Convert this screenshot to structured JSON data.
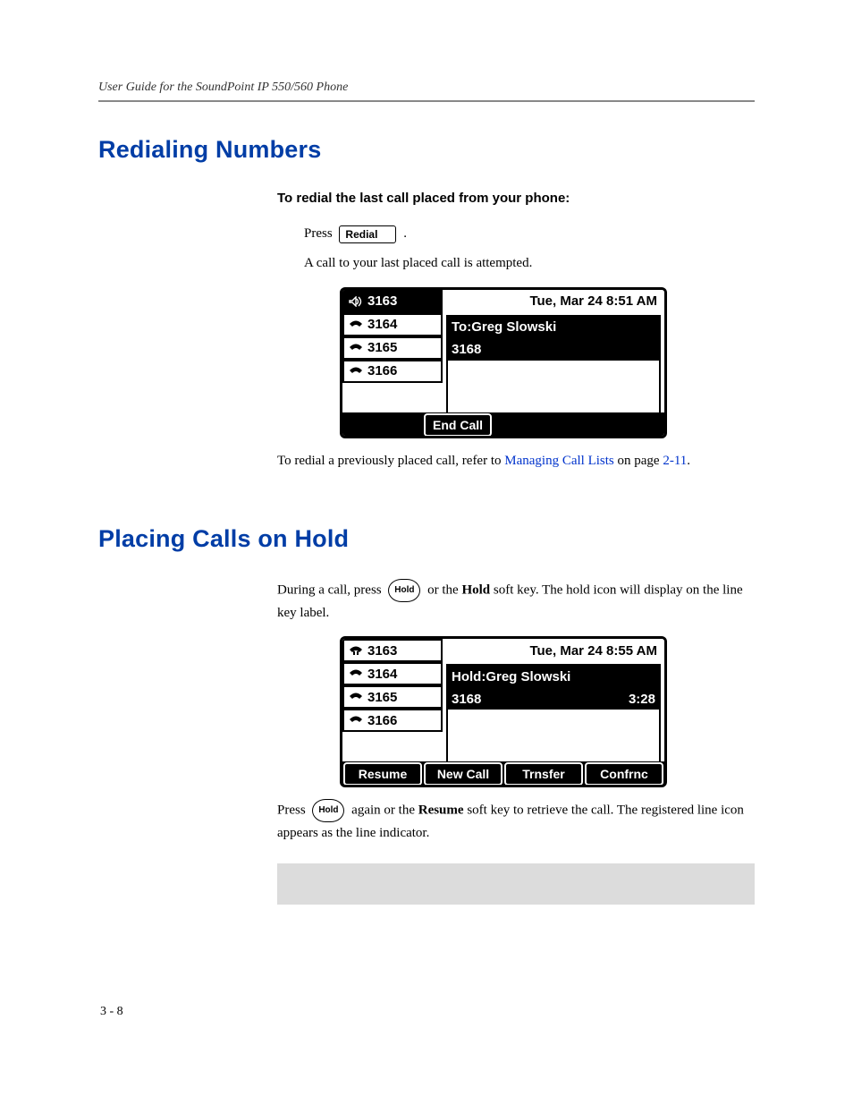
{
  "header": "User Guide for the SoundPoint IP 550/560 Phone",
  "page_num": "3 - 8",
  "sec1": {
    "title": "Redialing Numbers",
    "subhead": "To redial the last call placed from your phone:",
    "press_prefix": "Press ",
    "redial_label": "Redial",
    "press_suffix": " .",
    "line2": "A call to your last placed call is attempted.",
    "ref_prefix": "To redial a previously placed call, refer to ",
    "ref_link": "Managing Call Lists",
    "ref_mid": " on page ",
    "ref_page": "2-11",
    "ref_suffix": "."
  },
  "screen1": {
    "lines": [
      "3163",
      "3164",
      "3165",
      "3166"
    ],
    "datetime": "Tue, Mar 24  8:51 AM",
    "to": "To:Greg Slowski",
    "num": "3168",
    "softkeys": [
      "End Call"
    ]
  },
  "sec2": {
    "title": "Placing Calls on Hold",
    "p1_a": "During a call, press ",
    "hold_label": "Hold",
    "p1_b": " or the ",
    "p1_bold": "Hold",
    "p1_c": " soft key. The hold icon will display on the line key label.",
    "p2_a": "Press ",
    "p2_b": " again or the ",
    "p2_bold": "Resume",
    "p2_c": " soft key to retrieve the call. The registered line icon appears as the line indicator."
  },
  "screen2": {
    "lines": [
      "3163",
      "3164",
      "3165",
      "3166"
    ],
    "datetime": "Tue, Mar 24  8:55 AM",
    "hold": "Hold:Greg Slowski",
    "num": "3168",
    "time": "3:28",
    "softkeys": [
      "Resume",
      "New Call",
      "Trnsfer",
      "Confrnc"
    ]
  }
}
